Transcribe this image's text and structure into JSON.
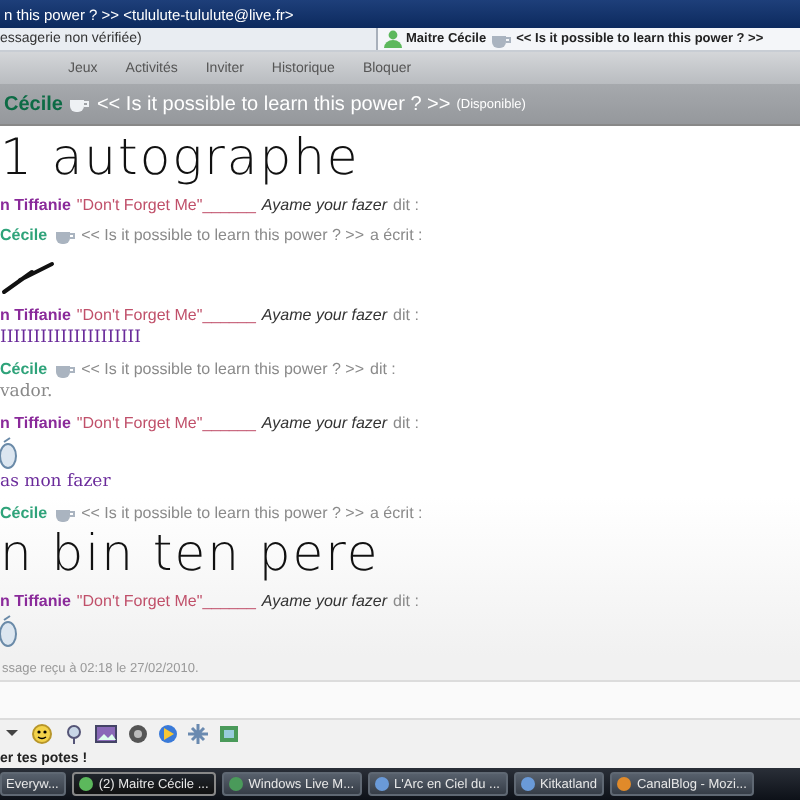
{
  "window": {
    "title": "n this power ? >> <tululute-tululute@live.fr>"
  },
  "warning": "essagerie non vérifiée)",
  "conversation_tab": {
    "label": "Maitre Cécile",
    "message": "<< Is it possible to learn this power ? >>",
    "selected": true
  },
  "menu": [
    "Jeux",
    "Activités",
    "Inviter",
    "Historique",
    "Bloquer"
  ],
  "contact": {
    "name": "Cécile",
    "message": "<< Is it possible to learn this power ?  >>",
    "status": "(Disponible)"
  },
  "messages": [
    {
      "kind": "ink",
      "text": "1 autographe"
    },
    {
      "kind": "header",
      "name": "n Tiffanie",
      "color": "#8a2a9a",
      "psm": "\"Don't Forget Me\"______",
      "alias": "Ayame your fazer",
      "verb": "dit :"
    },
    {
      "kind": "header",
      "name": "Cécile",
      "color": "#2fa37a",
      "icon": true,
      "psm": "<< Is it possible to learn this power ?  >>",
      "verb": "a écrit :"
    },
    {
      "kind": "drawing"
    },
    {
      "kind": "header",
      "name": "n Tiffanie",
      "color": "#8a2a9a",
      "psm": "\"Don't Forget Me\"______",
      "alias": "Ayame your fazer",
      "verb": "dit :"
    },
    {
      "kind": "text",
      "text": "IIIIIIIIIIIIIIIIIIIII",
      "color": "#6a2a9a"
    },
    {
      "kind": "header",
      "name": "Cécile",
      "color": "#2fa37a",
      "icon": true,
      "psm": "<< Is it possible to learn this power ?  >>",
      "verb": "dit :"
    },
    {
      "kind": "text",
      "text": "vador.",
      "color": "#888888"
    },
    {
      "kind": "header",
      "name": "n Tiffanie",
      "color": "#8a2a9a",
      "psm": "\"Don't Forget Me\"______",
      "alias": "Ayame your fazer",
      "verb": "dit :"
    },
    {
      "kind": "emoticon"
    },
    {
      "kind": "text",
      "text": "as mon fazer",
      "color": "#6a2a9a"
    },
    {
      "kind": "header",
      "name": "Cécile",
      "color": "#2fa37a",
      "icon": true,
      "psm": "<< Is it possible to learn this power ?  >>",
      "verb": "a écrit :"
    },
    {
      "kind": "ink",
      "text": "n bin ten pere"
    },
    {
      "kind": "header",
      "name": "n Tiffanie",
      "color": "#8a2a9a",
      "psm": "\"Don't Forget Me\"______",
      "alias": "Ayame your fazer",
      "verb": "dit :"
    },
    {
      "kind": "emoticon"
    }
  ],
  "last_message": "ssage reçu à 02:18 le 27/02/2010.",
  "footer_link": "er tes potes !",
  "taskbar": [
    {
      "label": "Everyw...",
      "selected": false
    },
    {
      "label": "(2) Maitre Cécile ...",
      "selected": true
    },
    {
      "label": "Windows Live M...",
      "selected": false
    },
    {
      "label": "L'Arc en Ciel du ...",
      "selected": false
    },
    {
      "label": "Kitkatland",
      "selected": false
    },
    {
      "label": "CanalBlog - Mozi...",
      "selected": false
    }
  ]
}
